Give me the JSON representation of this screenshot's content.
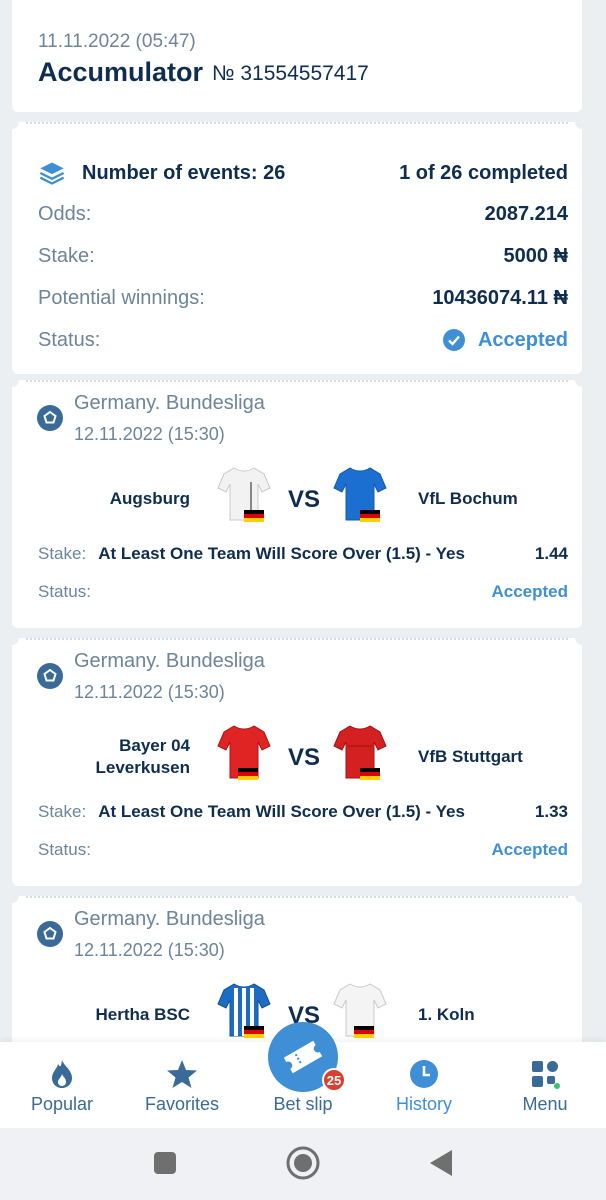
{
  "header": {
    "date": "11.11.2022 (05:47)",
    "title": "Accumulator",
    "number": "№ 31554557417"
  },
  "summary": {
    "events_label": "Number of events: 26",
    "completed": "1 of 26 completed",
    "odds_label": "Odds:",
    "odds_value": "2087.214",
    "stake_label": "Stake:",
    "stake_value": "5000 ₦",
    "winnings_label": "Potential winnings:",
    "winnings_value": "10436074.11 ₦",
    "status_label": "Status:",
    "status_value": "Accepted"
  },
  "events": [
    {
      "league": "Germany. Bundesliga",
      "date": "12.11.2022 (15:30)",
      "team1": "Augsburg",
      "team2": "VfL Bochum",
      "vs": "VS",
      "stake_label": "Stake:",
      "bet": "At Least One Team Will Score Over (1.5) - Yes",
      "odds": "1.44",
      "status_label": "Status:",
      "status": "Accepted",
      "shirt1_color": "#f2f2f2",
      "shirt2_color": "#1a6fd0"
    },
    {
      "league": "Germany. Bundesliga",
      "date": "12.11.2022 (15:30)",
      "team1_line1": "Bayer 04",
      "team1_line2": "Leverkusen",
      "team2": "VfB Stuttgart",
      "vs": "VS",
      "stake_label": "Stake:",
      "bet": "At Least One Team Will Score Over (1.5) - Yes",
      "odds": "1.33",
      "status_label": "Status:",
      "status": "Accepted",
      "shirt1_color": "#e02424",
      "shirt2_color": "#d42020"
    },
    {
      "league": "Germany. Bundesliga",
      "date": "12.11.2022 (15:30)",
      "team1": "Hertha BSC",
      "team2": "1. Koln",
      "vs": "VS",
      "shirt1_color": "#1c6cc4",
      "shirt2_color": "#f4f4f4"
    }
  ],
  "nav": {
    "popular": "Popular",
    "favorites": "Favorites",
    "betslip": "Bet slip",
    "betslip_badge": "25",
    "history": "History",
    "menu": "Menu"
  },
  "colors": {
    "accent": "#3e8fd6",
    "text_dark": "#0f2d4f",
    "text_muted": "#6d849a",
    "badge": "#d93f2e"
  }
}
